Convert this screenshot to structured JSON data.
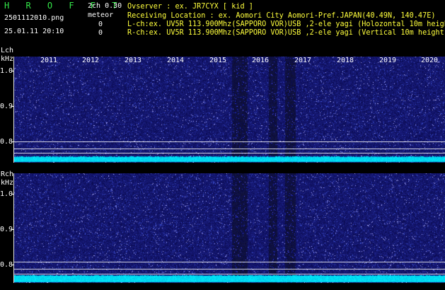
{
  "app": {
    "name": "H R O F F T",
    "channel_info": "2ch 0.30"
  },
  "file": {
    "name": "2501112010.png",
    "datetime": "25.01.11 20:10"
  },
  "meteor": {
    "label": "meteor",
    "lch_count": "0",
    "rch_count": "0"
  },
  "info": {
    "observer": "Ovserver          : ex. JR7CYX [ kid ]",
    "location": "Receiving Location : ex. Aomori City Aomori-Pref.JAPAN(40.49N, 140.47E)",
    "lch": "L-ch:ex. UV5R 113.900Mhz(SAPPORO VOR)USB ,2-ele yagi (Holozontal 10m height",
    "rch": "R-ch:ex. UV5R 113.900Mhz(SAPPORO VOR)USB ,2-ele yagi (Vertical 10m height)"
  },
  "axes": {
    "lch_label": "Lch",
    "unit": "kHz",
    "rch_label": "Rch",
    "ticks": [
      "1.0",
      "0.9",
      "0.8"
    ],
    "years": [
      "2011",
      "2012",
      "2013",
      "2014",
      "2015",
      "2016",
      "2017",
      "2018",
      "2019",
      "2020"
    ]
  },
  "colors": {
    "background": "#000000",
    "brand": "#34e84a",
    "info_text": "#ffff3c",
    "noise_base": "#14147a",
    "signal_band": "#00e5ff"
  }
}
